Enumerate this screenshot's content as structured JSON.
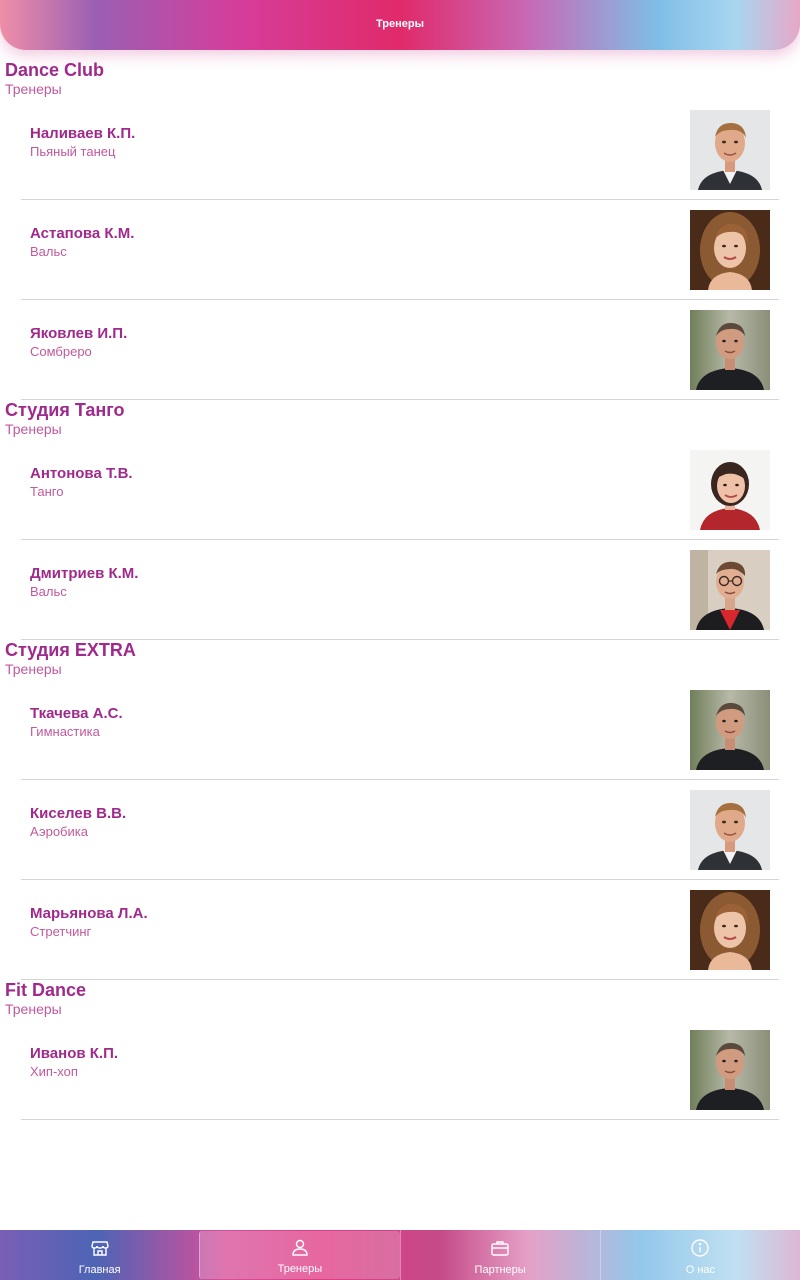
{
  "header": {
    "title": "Тренеры"
  },
  "sections": [
    {
      "title": "Dance Club",
      "subtitle": "Тренеры",
      "trainers": [
        {
          "name": "Наливаев К.П.",
          "specialty": "Пьяный танец",
          "photo": "man-suit"
        },
        {
          "name": "Астапова К.М.",
          "specialty": "Вальс",
          "photo": "woman-curly"
        },
        {
          "name": "Яковлев И.П.",
          "specialty": "Сомбреро",
          "photo": "man-black"
        }
      ]
    },
    {
      "title": "Студия Танго",
      "subtitle": "Тренеры",
      "trainers": [
        {
          "name": "Антонова Т.В.",
          "specialty": "Танго",
          "photo": "woman-red"
        },
        {
          "name": "Дмитриев К.М.",
          "specialty": "Вальс",
          "photo": "man-glasses"
        }
      ]
    },
    {
      "title": "Студия EXTRA",
      "subtitle": "Тренеры",
      "trainers": [
        {
          "name": "Ткачева А.С.",
          "specialty": "Гимнастика",
          "photo": "man-black"
        },
        {
          "name": "Киселев В.В.",
          "specialty": "Аэробика",
          "photo": "man-suit"
        },
        {
          "name": "Марьянова Л.А.",
          "specialty": "Стретчинг",
          "photo": "woman-curly"
        }
      ]
    },
    {
      "title": "Fit Dance",
      "subtitle": "Тренеры",
      "trainers": [
        {
          "name": "Иванов К.П.",
          "specialty": "Хип-хоп",
          "photo": "man-black"
        }
      ]
    }
  ],
  "tabs": [
    {
      "label": "Главная",
      "icon": "store-icon",
      "active": false
    },
    {
      "label": "Тренеры",
      "icon": "person-icon",
      "active": true
    },
    {
      "label": "Партнеры",
      "icon": "briefcase-icon",
      "active": false
    },
    {
      "label": "О нас",
      "icon": "info-icon",
      "active": false
    }
  ],
  "colors": {
    "title": "#a02a8c",
    "subtitle": "#c2589e",
    "divider": "#d6d6d6"
  }
}
